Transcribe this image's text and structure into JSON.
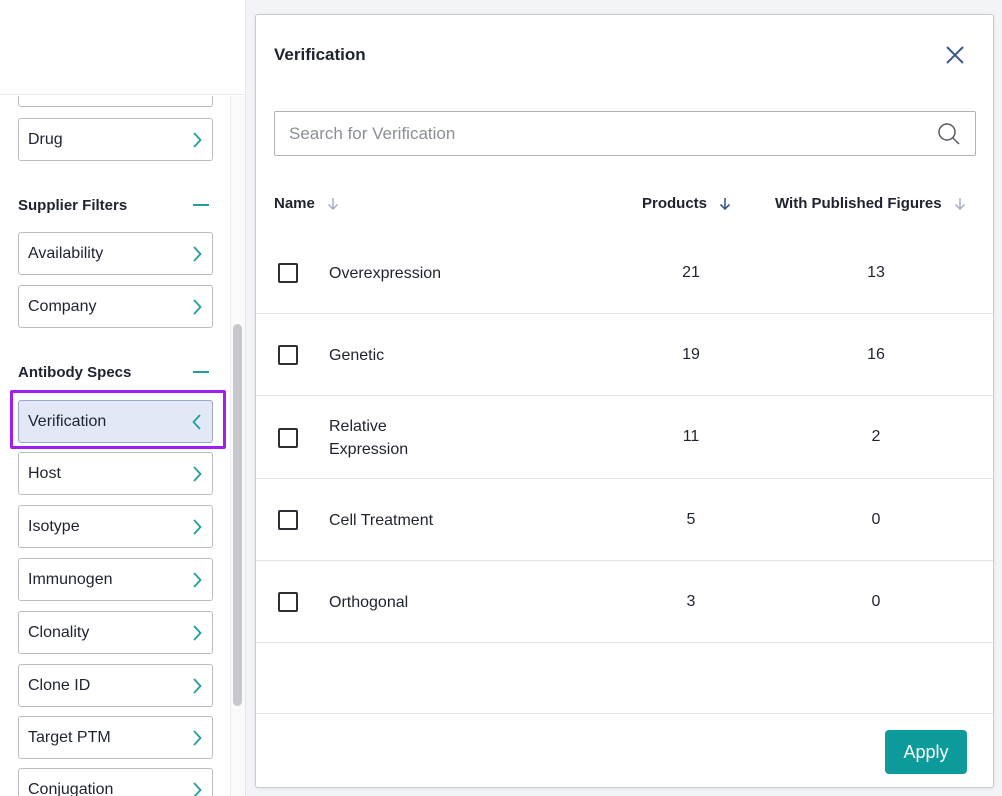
{
  "sidebar": {
    "drug_label": "Drug",
    "supplier_section": "Supplier Filters",
    "supplier_items": [
      "Availability",
      "Company"
    ],
    "antibody_section": "Antibody Specs",
    "antibody_items": [
      "Verification",
      "Host",
      "Isotype",
      "Immunogen",
      "Clonality",
      "Clone ID",
      "Target PTM",
      "Conjugation"
    ],
    "active_item": "Verification"
  },
  "modal": {
    "title": "Verification",
    "search_placeholder": "Search for Verification",
    "columns": {
      "name": "Name",
      "products": "Products",
      "figures": "With Published Figures"
    },
    "rows": [
      {
        "name": "Overexpression",
        "products": "21",
        "figures": "13"
      },
      {
        "name": "Genetic",
        "products": "19",
        "figures": "16"
      },
      {
        "name": "Relative Expression",
        "products": "11",
        "figures": "2"
      },
      {
        "name": "Cell Treatment",
        "products": "5",
        "figures": "0"
      },
      {
        "name": "Orthogonal",
        "products": "3",
        "figures": "0"
      }
    ],
    "apply_label": "Apply"
  },
  "colors": {
    "accent": "#0c9a9a",
    "highlight": "#a21ef0",
    "active_bg": "#e3e8f7"
  }
}
